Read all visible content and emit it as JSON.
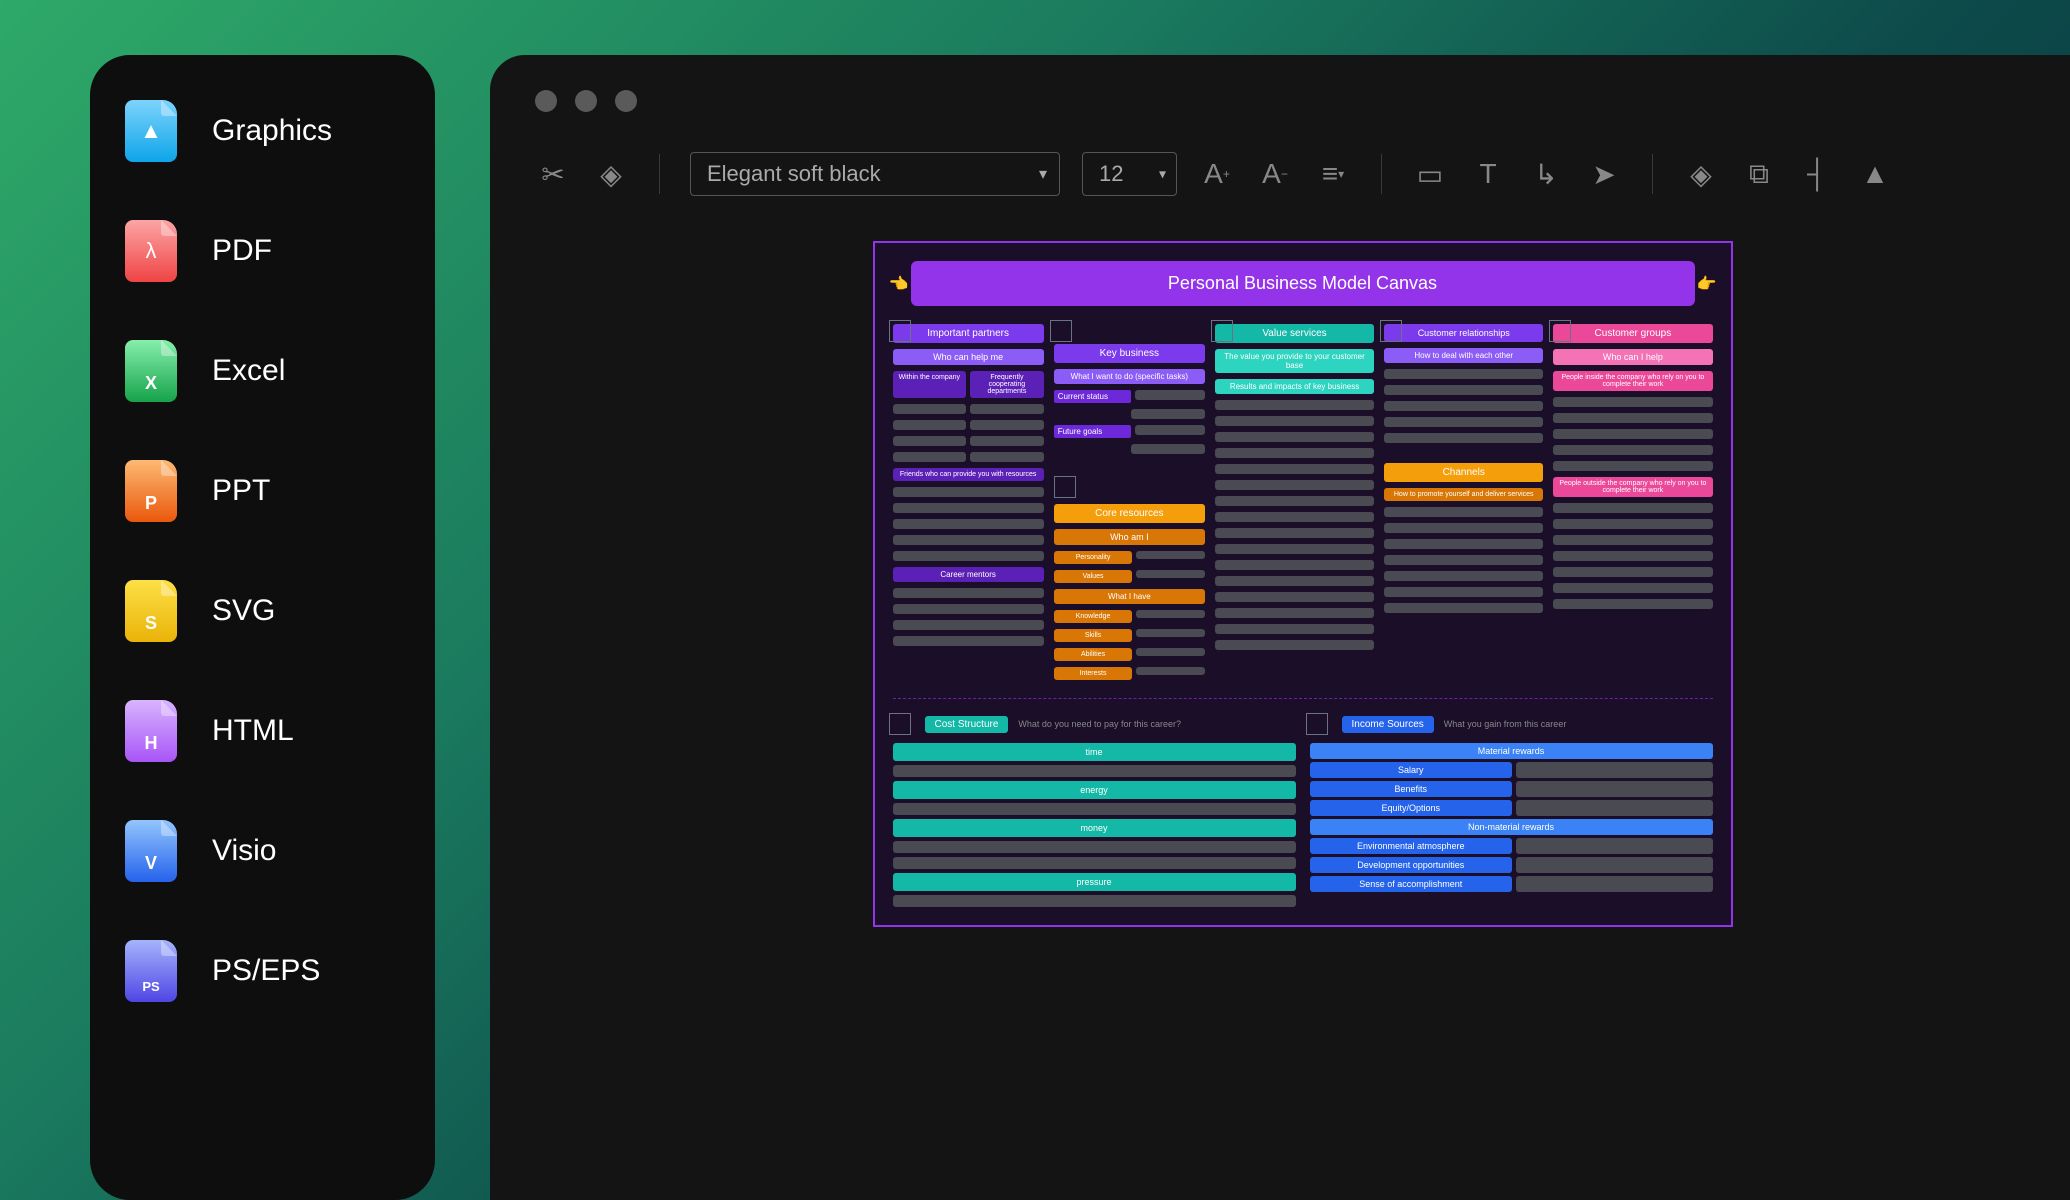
{
  "sidebar": {
    "items": [
      {
        "label": "Graphics"
      },
      {
        "label": "PDF"
      },
      {
        "label": "Excel"
      },
      {
        "label": "PPT"
      },
      {
        "label": "SVG"
      },
      {
        "label": "HTML"
      },
      {
        "label": "Visio"
      },
      {
        "label": "PS/EPS"
      }
    ]
  },
  "toolbar": {
    "font": "Elegant soft black",
    "size": "12"
  },
  "canvas": {
    "title": "Personal Business Model Canvas",
    "columns": {
      "partners": {
        "header": "Important partners",
        "sub": "Who can help me",
        "left_tag": "Within the company",
        "right_tag": "Frequently cooperating departments",
        "friends": "Friends who can provide you with resources",
        "mentors": "Career mentors"
      },
      "key_business": {
        "header": "Key business",
        "sub": "What I want to do (specific tasks)",
        "tag1": "Current status",
        "tag2": "Future goals"
      },
      "core_resources": {
        "header": "Core resources",
        "who": "Who am I",
        "items": [
          "Personality",
          "Values",
          "What I have",
          "Knowledge",
          "Skills",
          "Abilities",
          "Interests"
        ]
      },
      "value": {
        "header": "Value services",
        "sub1": "The value you provide to your customer base",
        "sub2": "Results and impacts of key business"
      },
      "relationships": {
        "header": "Customer relationships",
        "sub": "How to deal with each other"
      },
      "channels": {
        "header": "Channels",
        "sub": "How to promote yourself and deliver services"
      },
      "groups": {
        "header": "Customer groups",
        "sub": "Who can I help",
        "inside": "People inside the company who rely on you to complete their work",
        "outside": "People outside the company who rely on you to complete their work"
      }
    },
    "cost": {
      "header": "Cost Structure",
      "sub": "What do you need to pay for this career?",
      "items": [
        "time",
        "energy",
        "money",
        "pressure"
      ]
    },
    "income": {
      "header": "Income Sources",
      "sub": "What you gain from this career",
      "material_hdr": "Material rewards",
      "material": [
        "Salary",
        "Benefits",
        "Equity/Options"
      ],
      "nonmaterial_hdr": "Non-material rewards",
      "nonmaterial": [
        "Environmental atmosphere",
        "Development opportunities",
        "Sense of accomplishment"
      ]
    }
  }
}
